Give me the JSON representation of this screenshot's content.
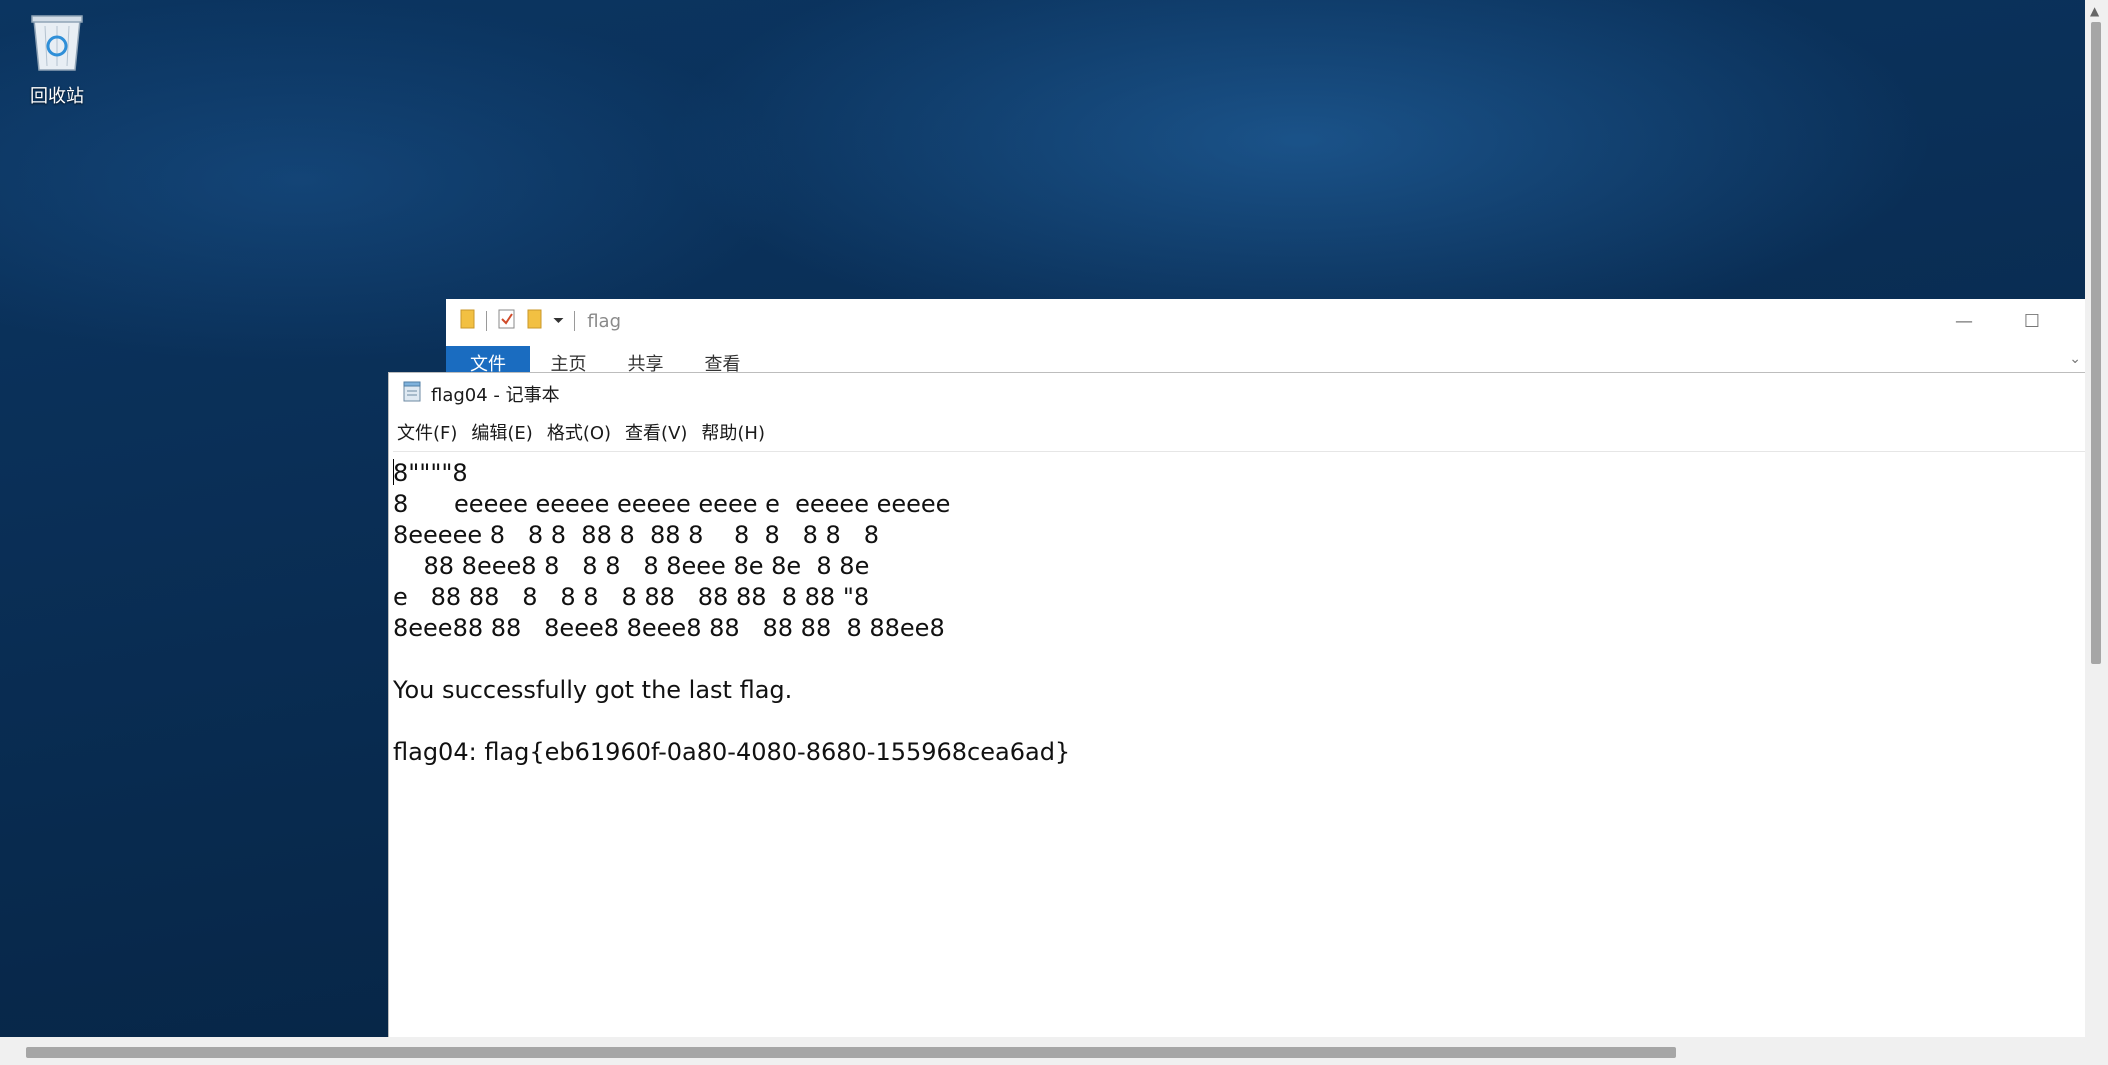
{
  "desktop": {
    "recycle_bin_label": "回收站"
  },
  "explorer": {
    "title": "flag",
    "tabs": [
      "文件",
      "主页",
      "共享",
      "查看"
    ]
  },
  "notepad": {
    "title": "flag04 - 记事本",
    "menu": [
      "文件(F)",
      "编辑(E)",
      "格式(O)",
      "查看(V)",
      "帮助(H)"
    ],
    "content": "8\"\"\"\"8\n8      eeeee eeeee eeeee eeee e  eeeee eeeee\n8eeeee 8   8 8  88 8  88 8    8  8   8 8   8\n    88 8eee8 8   8 8   8 8eee 8e 8e  8 8e\ne   88 88   8   8 8   8 88   88 88  8 88 \"8\n8eee88 88   8eee8 8eee8 88   88 88  8 88ee8\n\nYou successfully got the last flag.\n\nflag04: flag{eb61960f-0a80-4080-8680-155968cea6ad}"
  },
  "icons": {
    "recycle_bin": "recycle-bin-icon",
    "folder": "folder-icon",
    "properties": "properties-icon",
    "notepad": "notepad-icon"
  },
  "colors": {
    "ribbon_active_tab": "#1a6cc0",
    "desktop_background": "#0a2f57"
  }
}
